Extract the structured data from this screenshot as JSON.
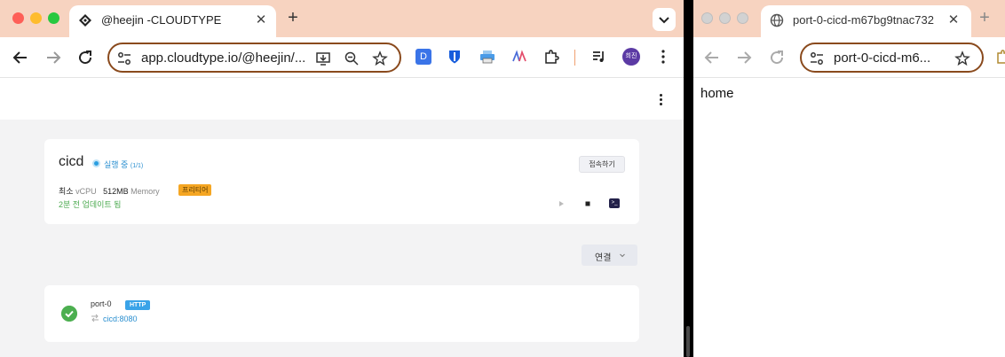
{
  "left_window": {
    "tab": {
      "title": "@heejin -CLOUDTYPE"
    },
    "omnibox": {
      "url": "app.cloudtype.io/@heejin/..."
    },
    "profile_initial": "희진",
    "extension_d_label": "D",
    "app": {
      "name": "cicd",
      "status": "실행 중",
      "status_count": "(1/1)",
      "connect_label": "접속하기",
      "spec_min": "최소",
      "spec_vcpu": "vCPU",
      "spec_memory_value": "512MB",
      "spec_memory_label": "Memory",
      "tier": "프리티어",
      "updated": "2분 전 업데이트 됨"
    },
    "link_dropdown": {
      "label": "연결"
    },
    "port": {
      "name": "port-0",
      "protocol": "HTTP",
      "target": "cicd:8080"
    }
  },
  "right_window": {
    "tab": {
      "title": "port-0-cicd-m67bg9tnac732"
    },
    "omnibox": {
      "url": "port-0-cicd-m6..."
    },
    "page_text": "home"
  },
  "colors": {
    "tab_bar": "#f7d3c0",
    "omnibox_border": "#8a4a1d",
    "status_blue": "#2a8fd0",
    "tier_orange": "#f5a623",
    "success_green": "#4caf50"
  }
}
